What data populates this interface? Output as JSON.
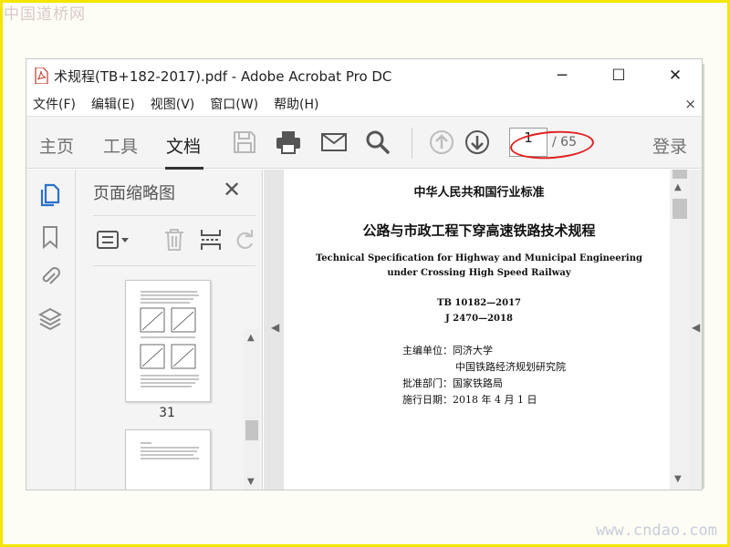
{
  "watermark": {
    "top": "中国道桥网",
    "bottom": "www.cndao.com"
  },
  "window": {
    "title": "术规程(TB+182-2017).pdf - Adobe Acrobat Pro DC",
    "controls": {
      "minimize": "─",
      "maximize": "☐",
      "close": "✕"
    }
  },
  "menubar": {
    "items": [
      "文件(F)",
      "编辑(E)",
      "视图(V)",
      "窗口(W)",
      "帮助(H)"
    ],
    "close": "×"
  },
  "toolbar": {
    "tabs": [
      "主页",
      "工具",
      "文档"
    ],
    "active_tab": "文档",
    "page_current": "1",
    "page_total": "/ 65",
    "login": "登录",
    "icons": [
      "save-icon",
      "print-icon",
      "email-icon",
      "search-icon",
      "previous-page-icon",
      "next-page-icon"
    ],
    "annotation_color": "#e02020"
  },
  "rail": {
    "icons": [
      "page-thumbnails-icon",
      "bookmark-icon",
      "attachment-icon",
      "layers-icon"
    ],
    "accent": "#2a72c8"
  },
  "panel": {
    "title": "页面缩略图",
    "close": "✕",
    "tools": [
      "options-menu-icon",
      "delete-icon",
      "insert-page-icon",
      "undo-icon"
    ],
    "thumbnails": [
      {
        "label": "31"
      },
      {
        "label": ""
      }
    ]
  },
  "document": {
    "lines": [
      "中华人民共和国行业标准",
      "公路与市政工程下穿高速铁路技术规程",
      "Technical Specification for Highway and Municipal Engineering",
      "under Crossing High Speed Railway",
      "TB 10182—2017",
      "J 2470—2018",
      "主编单位：同济大学",
      "中国铁路经济规划研究院",
      "批准部门：国家铁路局",
      "施行日期：2018 年 4 月 1 日"
    ]
  }
}
